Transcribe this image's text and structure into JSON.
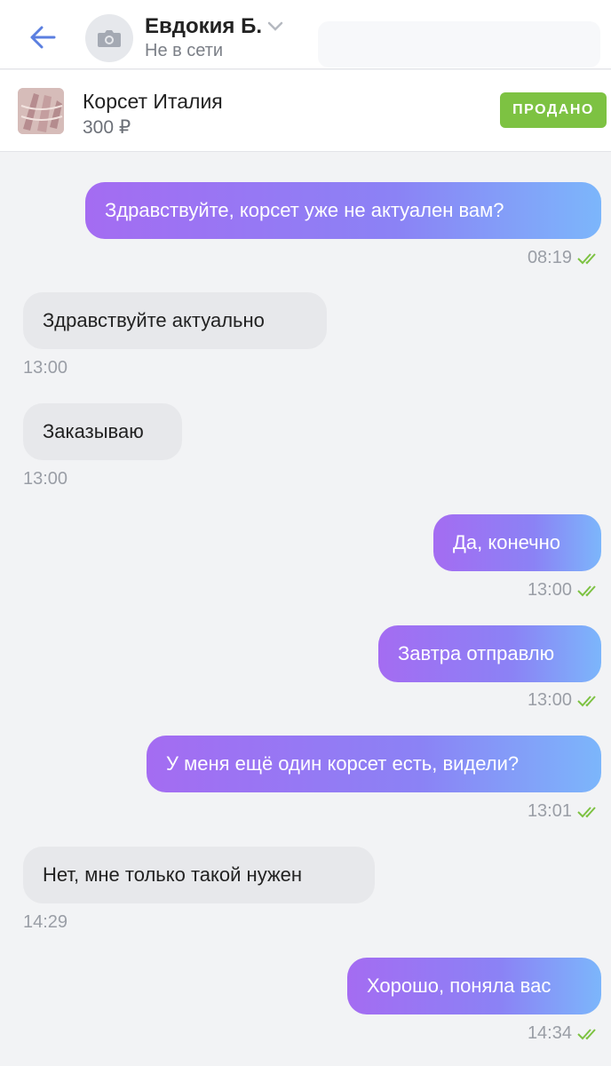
{
  "header": {
    "contact_name": "Евдокия Б.",
    "contact_status": "Не в сети",
    "accent_color": "#5b7fe0"
  },
  "product": {
    "title": "Корсет Италия",
    "price": "300 ₽",
    "badge": "ПРОДАНО",
    "badge_color": "#7dc242"
  },
  "messages": [
    {
      "direction": "out",
      "text": "Здравствуйте, корсет уже не актуален вам?",
      "time": "08:19",
      "read": true
    },
    {
      "direction": "in",
      "text": "Здравствуйте актуально",
      "time": "13:00"
    },
    {
      "direction": "in",
      "text": "Заказываю",
      "time": "13:00"
    },
    {
      "direction": "out",
      "text": "Да, конечно",
      "time": "13:00",
      "read": true
    },
    {
      "direction": "out",
      "text": "Завтра отправлю",
      "time": "13:00",
      "read": true
    },
    {
      "direction": "out",
      "text": "У меня ещё один корсет есть, видели?",
      "time": "13:01",
      "read": true
    },
    {
      "direction": "in",
      "text": "Нет, мне только такой нужен",
      "time": "14:29"
    },
    {
      "direction": "out",
      "text": "Хорошо, поняла вас",
      "time": "14:34",
      "read": true
    }
  ]
}
